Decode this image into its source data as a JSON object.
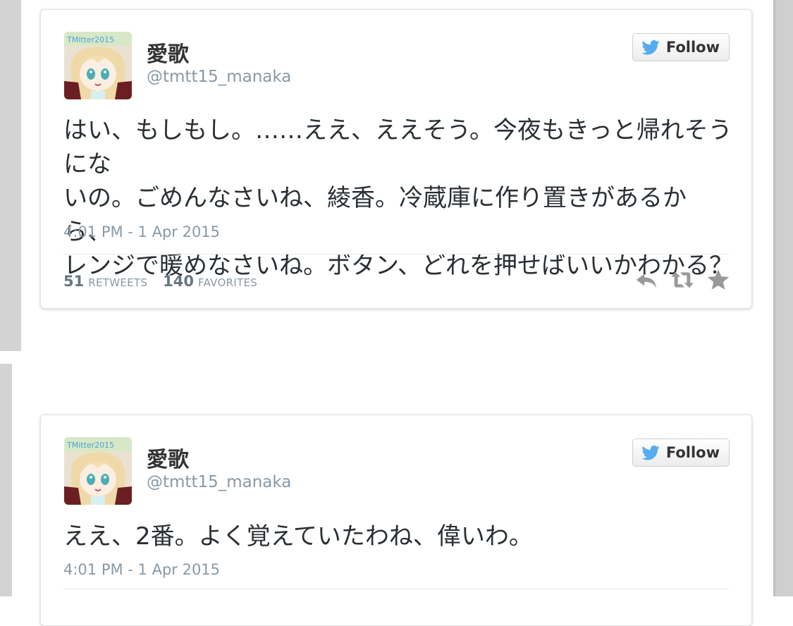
{
  "tweets": [
    {
      "display_name": "愛歌",
      "handle": "@tmtt15_manaka",
      "follow_label": "Follow",
      "text_lines": [
        "はい、もしもし。……ええ、ええそう。今夜もきっと帰れそうにな",
        "いの。ごめんなさいね、綾香。冷蔵庫に作り置きがあるから、",
        "レンジで暖めなさいね。ボタン、どれを押せばいいかわかる？"
      ],
      "timestamp": "4:01 PM - 1 Apr 2015",
      "retweets_count": "51",
      "retweets_label": "RETWEETS",
      "favorites_count": "140",
      "favorites_label": "FAVORITES"
    },
    {
      "display_name": "愛歌",
      "handle": "@tmtt15_manaka",
      "follow_label": "Follow",
      "text_lines": [
        "ええ、2番。よく覚えていたわね、偉いわ。"
      ],
      "timestamp": "4:01 PM - 1 Apr 2015"
    }
  ],
  "icons": {
    "follow": "twitter-bird-icon",
    "reply": "reply-icon",
    "retweet": "retweet-icon",
    "favorite": "star-icon"
  },
  "colors": {
    "twitter_blue": "#55acee",
    "action_gray": "#999999",
    "meta_gray": "#8899a6",
    "text": "#292f33"
  }
}
